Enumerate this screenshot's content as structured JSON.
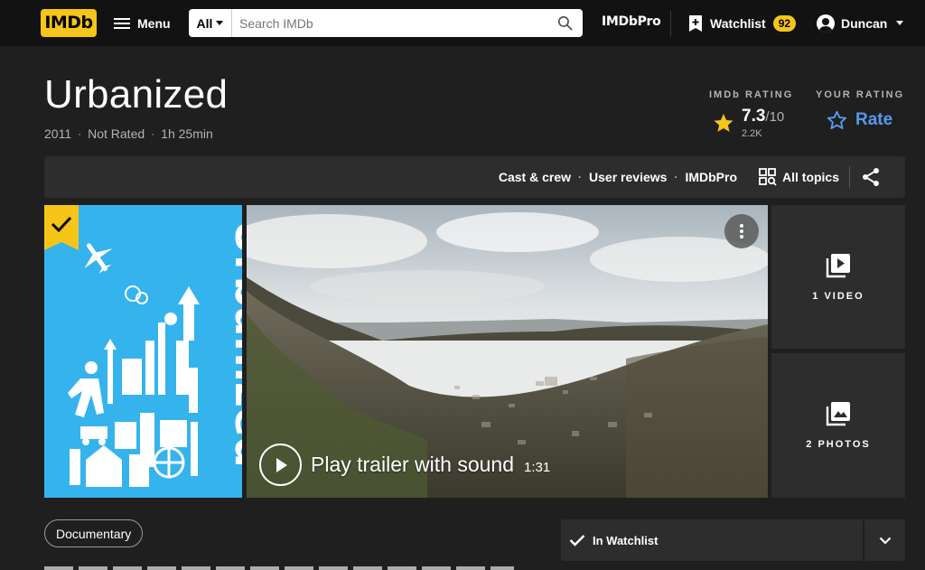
{
  "nav": {
    "logo": "IMDb",
    "menu_label": "Menu",
    "search_category": "All",
    "search_placeholder": "Search IMDb",
    "imdbpro": "IMDbPro",
    "watchlist_label": "Watchlist",
    "watchlist_count": "92",
    "user_name": "Duncan"
  },
  "title": {
    "name": "Urbanized",
    "year": "2011",
    "certificate": "Not Rated",
    "runtime": "1h 25min"
  },
  "rating": {
    "imdb_label": "IMDb RATING",
    "score": "7.3",
    "out_of": "/10",
    "votes": "2.2K",
    "your_label": "YOUR RATING",
    "rate_label": "Rate"
  },
  "subnav": {
    "links": [
      "Cast & crew",
      "User reviews",
      "IMDbPro"
    ],
    "all_topics": "All topics"
  },
  "poster": {
    "title_text": "Urbanized"
  },
  "trailer": {
    "play_label": "Play trailer with sound",
    "duration": "1:31"
  },
  "media_tiles": {
    "videos": "1 VIDEO",
    "photos": "2 PHOTOS"
  },
  "genres": [
    "Documentary"
  ],
  "watchlist_button": "In Watchlist",
  "colors": {
    "brand_yellow": "#f5c518",
    "rate_blue": "#5799ef",
    "poster_blue": "#35b3ed",
    "background": "#1f1f1f"
  }
}
